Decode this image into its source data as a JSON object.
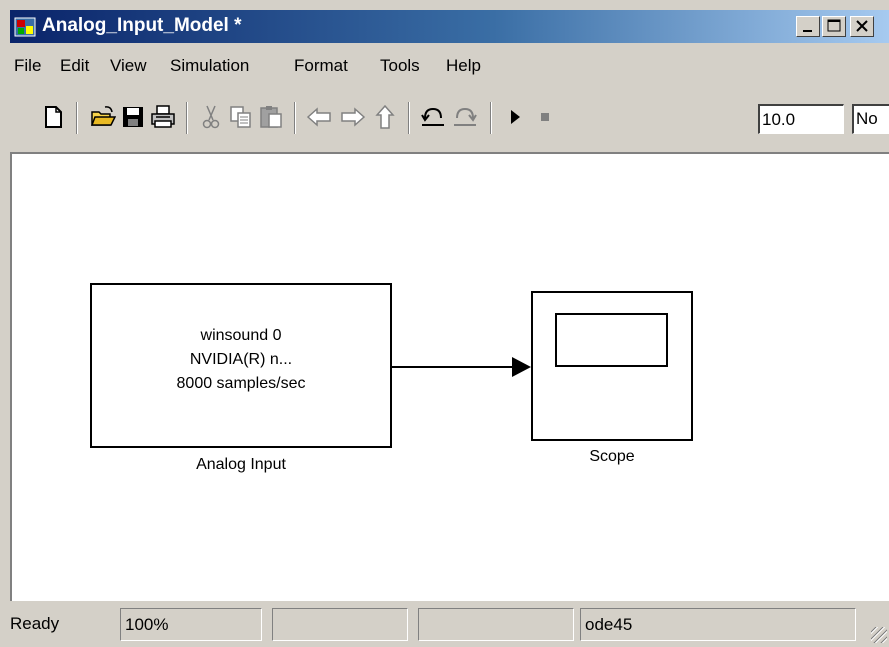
{
  "window": {
    "title": "Analog_Input_Model *",
    "minimize_label": "_",
    "maximize_label": "□",
    "close_label": "×"
  },
  "menu": {
    "items": [
      "File",
      "Edit",
      "View",
      "Simulation",
      "Format",
      "Tools",
      "Help"
    ]
  },
  "toolbar": {
    "buttons": [
      {
        "name": "new-model-icon"
      },
      {
        "name": "open-folder-icon"
      },
      {
        "name": "save-icon"
      },
      {
        "name": "print-icon"
      },
      {
        "name": "cut-icon"
      },
      {
        "name": "copy-icon"
      },
      {
        "name": "paste-icon"
      },
      {
        "name": "back-arrow-icon"
      },
      {
        "name": "forward-arrow-icon"
      },
      {
        "name": "up-arrow-icon"
      },
      {
        "name": "undo-icon"
      },
      {
        "name": "redo-icon"
      },
      {
        "name": "play-icon"
      },
      {
        "name": "stop-icon"
      }
    ],
    "stop_time": "10.0",
    "sim_mode_visible": "No"
  },
  "canvas": {
    "analog_input": {
      "lines": [
        "winsound 0",
        "NVIDIA(R) n...",
        "8000 samples/sec"
      ],
      "label": "Analog Input"
    },
    "scope": {
      "label": "Scope"
    }
  },
  "status": {
    "state": "Ready",
    "zoom": "100%",
    "pane3": "",
    "pane4": "",
    "solver": "ode45"
  },
  "colors": {
    "titlebar_start": "#0a246a",
    "titlebar_end": "#a6caf0",
    "chrome": "#d4d0c8",
    "canvas": "#ffffff"
  }
}
